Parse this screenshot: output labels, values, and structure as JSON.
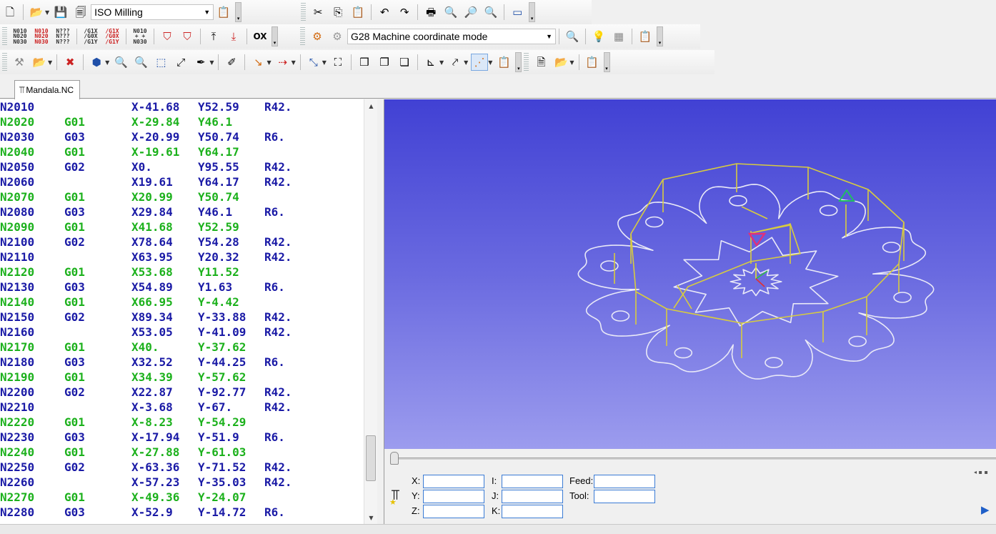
{
  "toolbar": {
    "machine_combo": "ISO Milling",
    "mode_combo": "G28 Machine coordinate mode",
    "icons_row1": [
      "new-file-icon",
      "open-folder-icon",
      "save-icon",
      "save-all-icon",
      "properties-icon",
      "cut-icon",
      "copy-icon",
      "paste-icon",
      "undo-icon",
      "redo-icon",
      "print-icon",
      "zoom-icon",
      "zoom-in-icon",
      "zoom-out-icon",
      "display-icon"
    ],
    "icons_row2": [
      "renumber-icon",
      "remove-numbers-icon",
      "number-query-icon",
      "g-code-icon",
      "remove-g-code-icon",
      "n-code-icon",
      "filter-icon",
      "filter-alt-icon",
      "upload-icon",
      "download-icon",
      "ox-icon",
      "machine-icon",
      "settings-icon",
      "search-icon",
      "bulb-icon",
      "grid-icon",
      "properties-icon"
    ],
    "row2_small": {
      "renumber": "N010\nN020\nN030",
      "remove_numbers": "N010\nN020\nN030",
      "number_query": "N???\nN???\nN???",
      "g_code": "/G1X\n/G0X\n/G1Y",
      "remove_g_code": "/G1X\n/G0X\n/G1Y",
      "n_code": "N010\n+ +\nN030",
      "ox": "OX"
    }
  },
  "tab": {
    "label": "Mandala.NC"
  },
  "code_lines": [
    {
      "n": "N2010",
      "g": "",
      "x": "X-41.68",
      "y": "Y52.59",
      "r": "R42.",
      "color": "blue"
    },
    {
      "n": "N2020",
      "g": "G01",
      "x": "X-29.84",
      "y": "Y46.1",
      "r": "",
      "color": "green"
    },
    {
      "n": "N2030",
      "g": "G03",
      "x": "X-20.99",
      "y": "Y50.74",
      "r": "R6.",
      "color": "blue"
    },
    {
      "n": "N2040",
      "g": "G01",
      "x": "X-19.61",
      "y": "Y64.17",
      "r": "",
      "color": "green"
    },
    {
      "n": "N2050",
      "g": "G02",
      "x": "X0.",
      "y": "Y95.55",
      "r": "R42.",
      "color": "blue"
    },
    {
      "n": "N2060",
      "g": "",
      "x": "X19.61",
      "y": "Y64.17",
      "r": "R42.",
      "color": "blue"
    },
    {
      "n": "N2070",
      "g": "G01",
      "x": "X20.99",
      "y": "Y50.74",
      "r": "",
      "color": "green"
    },
    {
      "n": "N2080",
      "g": "G03",
      "x": "X29.84",
      "y": "Y46.1",
      "r": "R6.",
      "color": "blue"
    },
    {
      "n": "N2090",
      "g": "G01",
      "x": "X41.68",
      "y": "Y52.59",
      "r": "",
      "color": "green"
    },
    {
      "n": "N2100",
      "g": "G02",
      "x": "X78.64",
      "y": "Y54.28",
      "r": "R42.",
      "color": "blue"
    },
    {
      "n": "N2110",
      "g": "",
      "x": "X63.95",
      "y": "Y20.32",
      "r": "R42.",
      "color": "blue"
    },
    {
      "n": "N2120",
      "g": "G01",
      "x": "X53.68",
      "y": "Y11.52",
      "r": "",
      "color": "green"
    },
    {
      "n": "N2130",
      "g": "G03",
      "x": "X54.89",
      "y": "Y1.63",
      "r": "R6.",
      "color": "blue"
    },
    {
      "n": "N2140",
      "g": "G01",
      "x": "X66.95",
      "y": "Y-4.42",
      "r": "",
      "color": "green"
    },
    {
      "n": "N2150",
      "g": "G02",
      "x": "X89.34",
      "y": "Y-33.88",
      "r": "R42.",
      "color": "blue"
    },
    {
      "n": "N2160",
      "g": "",
      "x": "X53.05",
      "y": "Y-41.09",
      "r": "R42.",
      "color": "blue"
    },
    {
      "n": "N2170",
      "g": "G01",
      "x": "X40.",
      "y": "Y-37.62",
      "r": "",
      "color": "green"
    },
    {
      "n": "N2180",
      "g": "G03",
      "x": "X32.52",
      "y": "Y-44.25",
      "r": "R6.",
      "color": "blue"
    },
    {
      "n": "N2190",
      "g": "G01",
      "x": "X34.39",
      "y": "Y-57.62",
      "r": "",
      "color": "green"
    },
    {
      "n": "N2200",
      "g": "G02",
      "x": "X22.87",
      "y": "Y-92.77",
      "r": "R42.",
      "color": "blue"
    },
    {
      "n": "N2210",
      "g": "",
      "x": "X-3.68",
      "y": "Y-67.",
      "r": "R42.",
      "color": "blue"
    },
    {
      "n": "N2220",
      "g": "G01",
      "x": "X-8.23",
      "y": "Y-54.29",
      "r": "",
      "color": "green"
    },
    {
      "n": "N2230",
      "g": "G03",
      "x": "X-17.94",
      "y": "Y-51.9",
      "r": "R6.",
      "color": "blue"
    },
    {
      "n": "N2240",
      "g": "G01",
      "x": "X-27.88",
      "y": "Y-61.03",
      "r": "",
      "color": "green"
    },
    {
      "n": "N2250",
      "g": "G02",
      "x": "X-63.36",
      "y": "Y-71.52",
      "r": "R42.",
      "color": "blue"
    },
    {
      "n": "N2260",
      "g": "",
      "x": "X-57.23",
      "y": "Y-35.03",
      "r": "R42.",
      "color": "blue"
    },
    {
      "n": "N2270",
      "g": "G01",
      "x": "X-49.36",
      "y": "Y-24.07",
      "r": "",
      "color": "green"
    },
    {
      "n": "N2280",
      "g": "G03",
      "x": "X-52.9",
      "y": "Y-14.72",
      "r": "R6.",
      "color": "blue"
    }
  ],
  "sim": {
    "x_label": "X:",
    "y_label": "Y:",
    "z_label": "Z:",
    "i_label": "I:",
    "j_label": "J:",
    "k_label": "K:",
    "feed_label": "Feed:",
    "tool_label": "Tool:"
  },
  "colors": {
    "code_blue": "#1a1aa6",
    "code_green": "#1cb11c",
    "viewport_top": "#4141d4",
    "viewport_bottom": "#9c9cee",
    "path_white": "#e9e9f7",
    "path_yellow": "#d8cc3e"
  }
}
